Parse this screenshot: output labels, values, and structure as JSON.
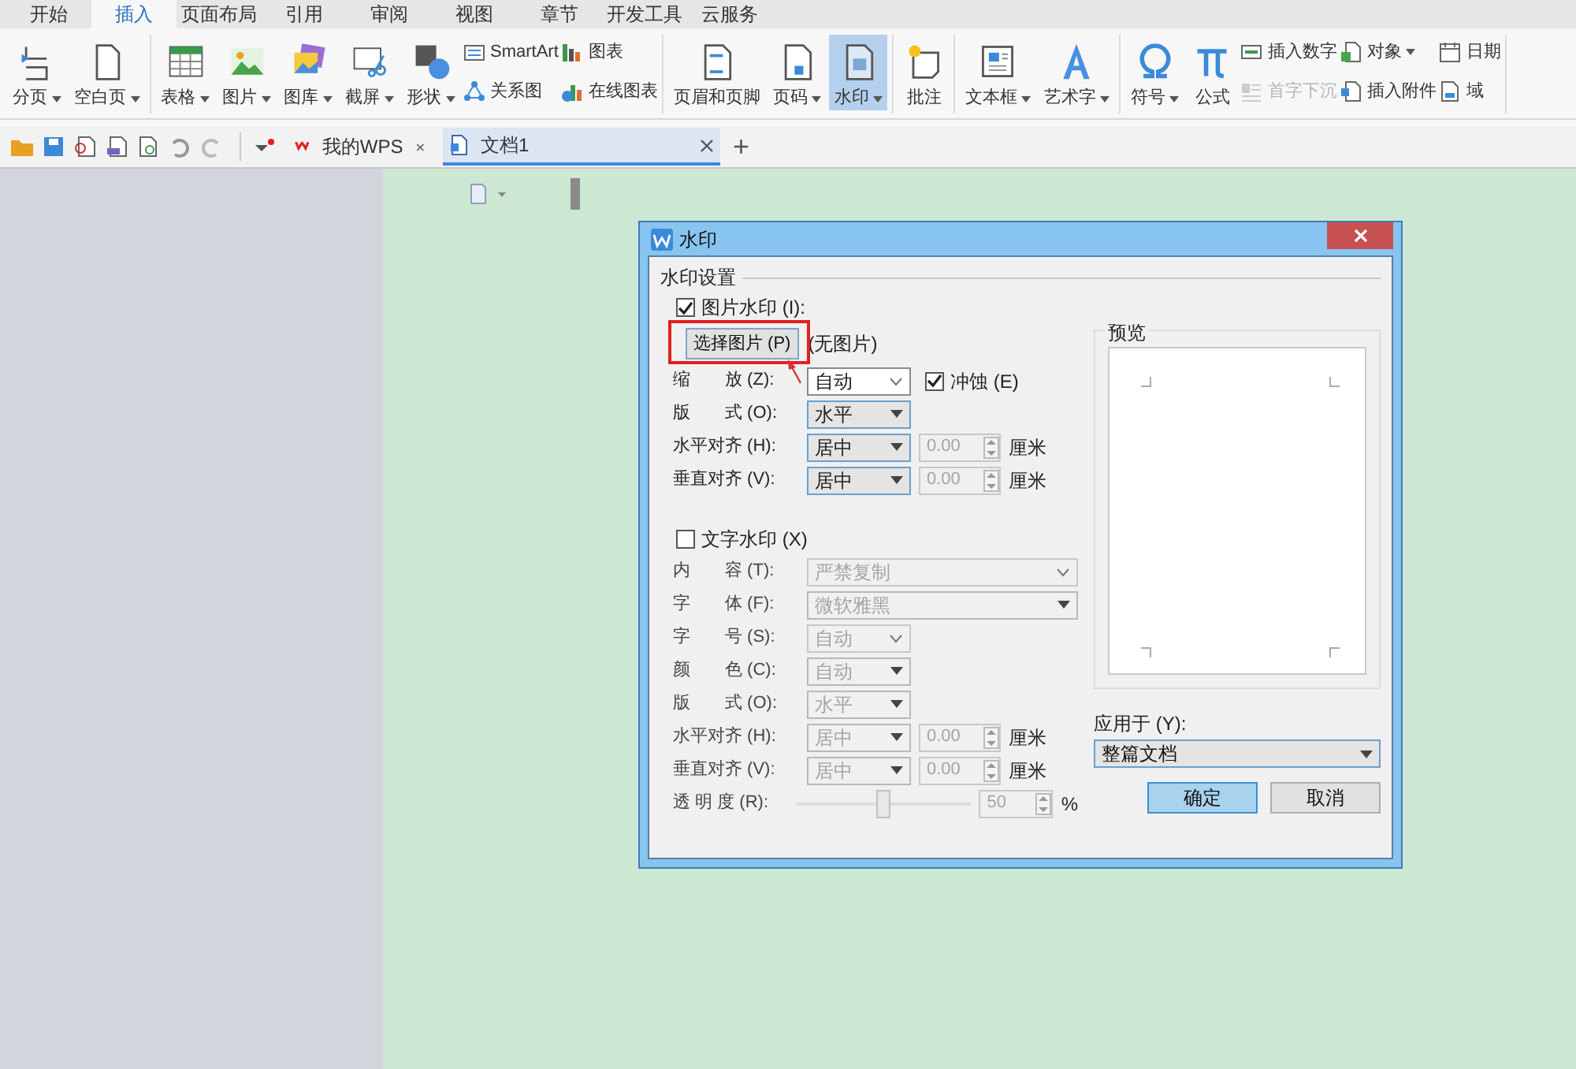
{
  "tabs": [
    {
      "label": "开始",
      "selected": false
    },
    {
      "label": "插入",
      "selected": true
    },
    {
      "label": "页面布局",
      "selected": false
    },
    {
      "label": "引用",
      "selected": false
    },
    {
      "label": "审阅",
      "selected": false
    },
    {
      "label": "视图",
      "selected": false
    },
    {
      "label": "章节",
      "selected": false
    },
    {
      "label": "开发工具",
      "selected": false
    },
    {
      "label": "云服务",
      "selected": false
    }
  ],
  "ribbon": [
    {
      "items": [
        {
          "kind": "large",
          "label": "分页",
          "dropdown": true,
          "selected": false
        },
        {
          "kind": "large",
          "label": "空白页",
          "dropdown": true,
          "selected": false
        }
      ]
    },
    {
      "items": [
        {
          "kind": "large",
          "label": "表格",
          "dropdown": true,
          "selected": false
        },
        {
          "kind": "large",
          "label": "图片",
          "dropdown": true,
          "selected": false
        },
        {
          "kind": "large",
          "label": "图库",
          "dropdown": true,
          "selected": false
        },
        {
          "kind": "large",
          "label": "截屏",
          "dropdown": true,
          "selected": false
        },
        {
          "kind": "large",
          "label": "形状",
          "dropdown": true,
          "selected": false
        },
        {
          "kind": "stack",
          "items": [
            {
              "label": "SmartArt",
              "dropdown": false,
              "disabled": false
            },
            {
              "label": "关系图",
              "dropdown": false,
              "disabled": false
            }
          ]
        },
        {
          "kind": "stack",
          "items": [
            {
              "label": "图表",
              "dropdown": false,
              "disabled": false
            },
            {
              "label": "在线图表",
              "dropdown": false,
              "disabled": false
            }
          ]
        }
      ]
    },
    {
      "items": [
        {
          "kind": "large",
          "label": "页眉和页脚",
          "dropdown": false,
          "selected": false
        },
        {
          "kind": "large",
          "label": "页码",
          "dropdown": true,
          "selected": false
        },
        {
          "kind": "large",
          "label": "水印",
          "dropdown": true,
          "selected": true
        }
      ]
    },
    {
      "items": [
        {
          "kind": "large",
          "label": "批注",
          "dropdown": false,
          "selected": false
        }
      ]
    },
    {
      "items": [
        {
          "kind": "large",
          "label": "文本框",
          "dropdown": true,
          "selected": false
        },
        {
          "kind": "large",
          "label": "艺术字",
          "dropdown": true,
          "selected": false
        }
      ]
    },
    {
      "items": [
        {
          "kind": "large",
          "label": "符号",
          "dropdown": true,
          "selected": false
        },
        {
          "kind": "large",
          "label": "公式",
          "dropdown": false,
          "selected": false
        },
        {
          "kind": "stack",
          "items": [
            {
              "label": "插入数字",
              "dropdown": false,
              "disabled": false
            },
            {
              "label": "首字下沉",
              "dropdown": false,
              "disabled": true
            }
          ]
        },
        {
          "kind": "stack",
          "items": [
            {
              "label": "对象",
              "dropdown": true,
              "disabled": false
            },
            {
              "label": "插入附件",
              "dropdown": false,
              "disabled": false
            }
          ]
        },
        {
          "kind": "stack",
          "items": [
            {
              "label": "日期",
              "dropdown": false,
              "disabled": false
            },
            {
              "label": "域",
              "dropdown": false,
              "disabled": false
            }
          ]
        }
      ]
    }
  ],
  "doc_tabs": [
    {
      "label": "我的WPS",
      "selected": false
    },
    {
      "label": "文档1",
      "selected": true
    }
  ],
  "new_tab": "+",
  "dialog": {
    "title": "水印",
    "group_label": "水印设置",
    "picture_watermark": {
      "label": "图片水印 (I):",
      "checked": true,
      "select_button": "选择图片 (P)",
      "status": "(无图片)",
      "rows": [
        {
          "label": "缩　　放 (Z):",
          "controls": [
            {
              "kind": "combo",
              "value": "自动",
              "disabled": false
            },
            {
              "kind": "checkbox",
              "value": "冲蚀 (E)",
              "checked": true
            }
          ]
        },
        {
          "label": "版　　式 (O):",
          "controls": [
            {
              "kind": "select",
              "value": "水平",
              "disabled": false
            }
          ]
        },
        {
          "label": "水平对齐 (H):",
          "controls": [
            {
              "kind": "select",
              "value": "居中",
              "disabled": false
            },
            {
              "kind": "spin",
              "value": "0.00",
              "disabled": true
            },
            {
              "kind": "unit",
              "value": "厘米"
            }
          ]
        },
        {
          "label": "垂直对齐 (V):",
          "controls": [
            {
              "kind": "select",
              "value": "居中",
              "disabled": false
            },
            {
              "kind": "spin",
              "value": "0.00",
              "disabled": true
            },
            {
              "kind": "unit",
              "value": "厘米"
            }
          ]
        }
      ]
    },
    "text_watermark": {
      "label": "文字水印 (X)",
      "checked": false,
      "rows": [
        {
          "label": "内　　容 (T):",
          "controls": [
            {
              "kind": "wide_combo",
              "value": "严禁复制",
              "disabled": true
            }
          ]
        },
        {
          "label": "字　　体 (F):",
          "controls": [
            {
              "kind": "wide_select",
              "value": "微软雅黑",
              "disabled": true
            }
          ]
        },
        {
          "label": "字　　号 (S):",
          "controls": [
            {
              "kind": "combo",
              "value": "自动",
              "disabled": true
            }
          ]
        },
        {
          "label": "颜　　色 (C):",
          "controls": [
            {
              "kind": "select",
              "value": "自动",
              "disabled": true
            }
          ]
        },
        {
          "label": "版　　式 (O):",
          "controls": [
            {
              "kind": "select",
              "value": "水平",
              "disabled": true
            }
          ]
        },
        {
          "label": "水平对齐 (H):",
          "controls": [
            {
              "kind": "select",
              "value": "居中",
              "disabled": true
            },
            {
              "kind": "spin",
              "value": "0.00",
              "disabled": true
            },
            {
              "kind": "unit",
              "value": "厘米"
            }
          ]
        },
        {
          "label": "垂直对齐 (V):",
          "controls": [
            {
              "kind": "select",
              "value": "居中",
              "disabled": true
            },
            {
              "kind": "spin",
              "value": "0.00",
              "disabled": true
            },
            {
              "kind": "unit",
              "value": "厘米"
            }
          ]
        },
        {
          "label": "透 明 度 (R):",
          "controls": [
            {
              "kind": "slider",
              "level": 0.5,
              "disabled": true
            },
            {
              "kind": "spin",
              "value": "50",
              "disabled": true
            },
            {
              "kind": "unit",
              "value": "%"
            }
          ]
        }
      ]
    },
    "preview_label": "预览",
    "apply_to": {
      "label": "应用于 (Y):",
      "value": "整篇文档"
    },
    "buttons": [
      {
        "label": "确定",
        "selected": true
      },
      {
        "label": "取消",
        "selected": false
      }
    ]
  }
}
